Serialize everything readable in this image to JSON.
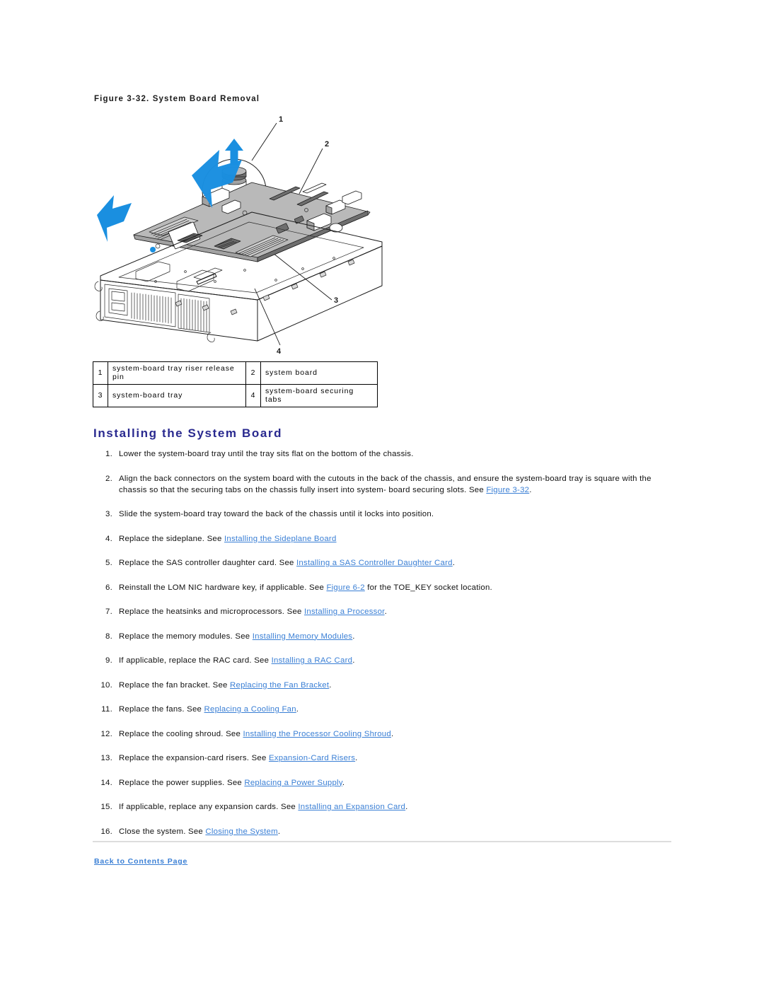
{
  "figure": {
    "caption": "Figure 3-32. System Board Removal",
    "callouts": [
      {
        "number": "1",
        "name": "system-board tray riser release pin"
      },
      {
        "number": "2",
        "name": "system board"
      },
      {
        "number": "3",
        "name": "system-board tray"
      },
      {
        "number": "4",
        "name": "system-board securing tabs"
      }
    ],
    "arrow_color": "#1a8fe0",
    "line_color": "#1a1a1a"
  },
  "legend": {
    "rows": [
      {
        "n1": "1",
        "t1": "system-board tray riser release pin",
        "n2": "2",
        "t2": "system board"
      },
      {
        "n1": "3",
        "t1": "system-board tray",
        "n2": "4",
        "t2": "system-board securing tabs"
      }
    ]
  },
  "heading": {
    "title": "Installing the System Board",
    "color": "#29298f"
  },
  "steps": [
    {
      "marker": "1.",
      "segments": [
        {
          "type": "text",
          "value": "Lower the system-board tray until the tray sits flat on the bottom of the chassis."
        }
      ]
    },
    {
      "marker": "2.",
      "segments": [
        {
          "type": "text",
          "value": "Align the back connectors on the system board with the cutouts in the back of the chassis, and ensure the system-board tray is square with the chassis so that the securing tabs on the chassis fully insert into system- board securing slots. See "
        },
        {
          "type": "link",
          "value": "Figure 3-32"
        },
        {
          "type": "text",
          "value": "."
        }
      ]
    },
    {
      "marker": "3.",
      "segments": [
        {
          "type": "text",
          "value": "Slide the system-board tray toward the back of the chassis until it locks into position."
        }
      ]
    },
    {
      "marker": "4.",
      "segments": [
        {
          "type": "text",
          "value": "Replace the sideplane. See "
        },
        {
          "type": "link",
          "value": "Installing the Sideplane Board"
        }
      ]
    },
    {
      "marker": "5.",
      "segments": [
        {
          "type": "text",
          "value": "Replace the SAS controller daughter card. See "
        },
        {
          "type": "link",
          "value": "Installing a SAS Controller Daughter Card"
        },
        {
          "type": "text",
          "value": "."
        }
      ]
    },
    {
      "marker": "6.",
      "segments": [
        {
          "type": "text",
          "value": "Reinstall the LOM NIC hardware key, if applicable. See "
        },
        {
          "type": "link",
          "value": "Figure 6-2"
        },
        {
          "type": "text",
          "value": " for the TOE_KEY socket location."
        }
      ]
    },
    {
      "marker": "7.",
      "segments": [
        {
          "type": "text",
          "value": "Replace the heatsinks and microprocessors. See "
        },
        {
          "type": "link",
          "value": "Installing a Processor"
        },
        {
          "type": "text",
          "value": "."
        }
      ]
    },
    {
      "marker": "8.",
      "segments": [
        {
          "type": "text",
          "value": "Replace the memory modules. See "
        },
        {
          "type": "link",
          "value": "Installing Memory Modules"
        },
        {
          "type": "text",
          "value": "."
        }
      ]
    },
    {
      "marker": "9.",
      "segments": [
        {
          "type": "text",
          "value": "If applicable, replace the RAC card. See "
        },
        {
          "type": "link",
          "value": "Installing a RAC Card"
        },
        {
          "type": "text",
          "value": "."
        }
      ]
    },
    {
      "marker": "10.",
      "segments": [
        {
          "type": "text",
          "value": "Replace the fan bracket. See "
        },
        {
          "type": "link",
          "value": "Replacing the Fan Bracket"
        },
        {
          "type": "text",
          "value": "."
        }
      ]
    },
    {
      "marker": "11.",
      "segments": [
        {
          "type": "text",
          "value": "Replace the fans. See "
        },
        {
          "type": "link",
          "value": "Replacing a Cooling Fan"
        },
        {
          "type": "text",
          "value": "."
        }
      ]
    },
    {
      "marker": "12.",
      "segments": [
        {
          "type": "text",
          "value": "Replace the cooling shroud. See "
        },
        {
          "type": "link",
          "value": "Installing the Processor Cooling Shroud"
        },
        {
          "type": "text",
          "value": "."
        }
      ]
    },
    {
      "marker": "13.",
      "segments": [
        {
          "type": "text",
          "value": "Replace the expansion-card risers. See "
        },
        {
          "type": "link",
          "value": "Expansion-Card Risers"
        },
        {
          "type": "text",
          "value": "."
        }
      ]
    },
    {
      "marker": "14.",
      "segments": [
        {
          "type": "text",
          "value": "Replace the power supplies. See "
        },
        {
          "type": "link",
          "value": "Replacing a Power Supply"
        },
        {
          "type": "text",
          "value": "."
        }
      ]
    },
    {
      "marker": "15.",
      "segments": [
        {
          "type": "text",
          "value": "If applicable, replace any expansion cards. See "
        },
        {
          "type": "link",
          "value": "Installing an Expansion Card"
        },
        {
          "type": "text",
          "value": "."
        }
      ]
    },
    {
      "marker": "16.",
      "segments": [
        {
          "type": "text",
          "value": "Close the system. See "
        },
        {
          "type": "link",
          "value": "Closing the System"
        },
        {
          "type": "text",
          "value": "."
        }
      ]
    }
  ],
  "footer": {
    "back_link": "Back to Contents Page",
    "link_color": "#3a7fd5"
  }
}
